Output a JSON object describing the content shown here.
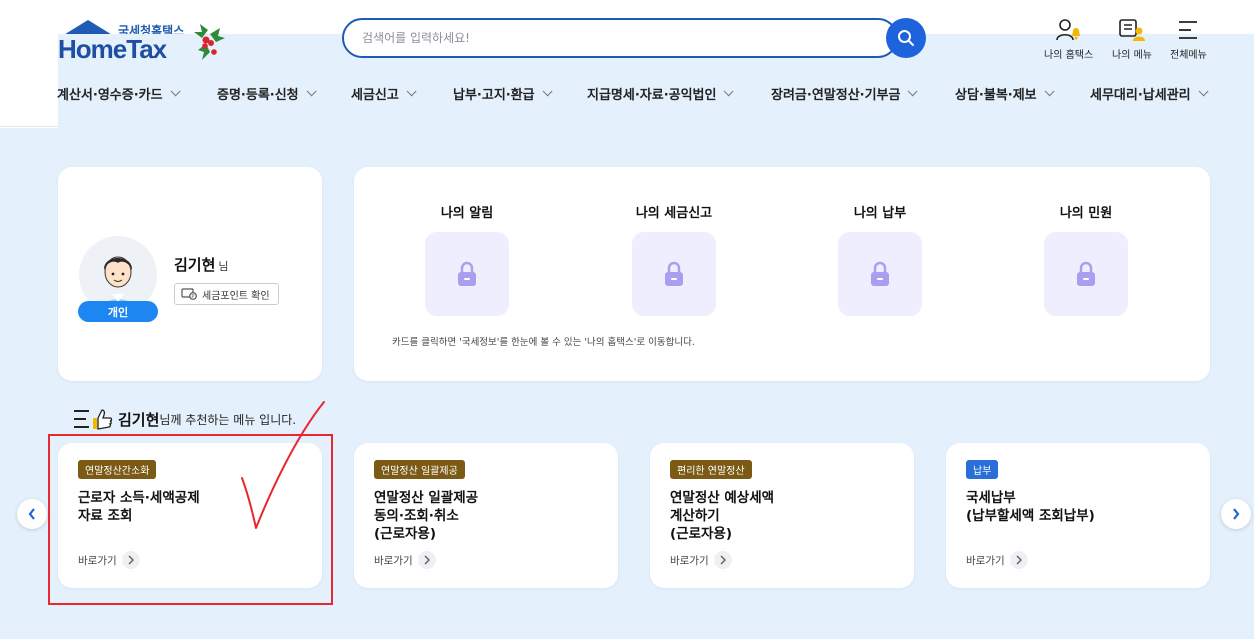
{
  "header": {
    "logo": {
      "sub": "국세청홈택스",
      "main": "HomeTax"
    },
    "search": {
      "placeholder": "검색어를 입력하세요!"
    },
    "utils": [
      {
        "label": "나의 홈택스",
        "icon": "person-bell-icon"
      },
      {
        "label": "나의 메뉴",
        "icon": "menu-person-icon"
      },
      {
        "label": "전체메뉴",
        "icon": "hamburger-icon"
      }
    ],
    "nav": [
      "계산서·영수증·카드",
      "증명·등록·신청",
      "세금신고",
      "납부·고지·환급",
      "지급명세·자료·공익법인",
      "장려금·연말정산·기부금",
      "상담·불복·제보",
      "세무대리·납세관리"
    ]
  },
  "profile": {
    "name": "김기현",
    "honorific": "님",
    "tax_point_label": "세금포인트 확인",
    "type_badge": "개인"
  },
  "my_section": {
    "items": [
      "나의 알림",
      "나의 세금신고",
      "나의 납부",
      "나의 민원"
    ],
    "note": "카드를 클릭하면 '국세정보'를 한눈에 볼 수 있는 '나의 홈택스'로 이동합니다."
  },
  "recommend": {
    "name": "김기현",
    "suffix": "님께 추천하는 메뉴 입니다."
  },
  "services": [
    {
      "tag": "연말정산간소화",
      "tag_color": "#7a5a14",
      "title": "근로자 소득·세액공제\n자료 조회",
      "link": "바로가기"
    },
    {
      "tag": "연말정산 일괄제공",
      "tag_color": "#7a5a14",
      "title": "연말정산 일괄제공\n동의·조회·취소\n(근로자용)",
      "link": "바로가기"
    },
    {
      "tag": "편리한 연말정산",
      "tag_color": "#7a5a14",
      "title": "연말정산 예상세액\n계산하기\n(근로자용)",
      "link": "바로가기"
    },
    {
      "tag": "납부",
      "tag_color": "#2a6fd8",
      "title": "국세납부\n(납부할세액 조회납부)",
      "link": "바로가기"
    }
  ],
  "colors": {
    "accent": "#1d63dc",
    "background": "#e4f0fb",
    "highlight": "#e8282f",
    "lock": "#a99ef0"
  }
}
